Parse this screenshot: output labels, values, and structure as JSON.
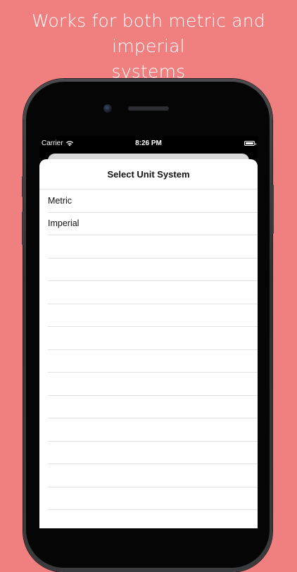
{
  "promo": {
    "headline_line1": "Works for both metric and imperial",
    "headline_line2": "systems"
  },
  "status_bar": {
    "carrier": "Carrier",
    "time": "8:26 PM"
  },
  "sheet": {
    "title": "Select Unit System",
    "options": [
      "Metric",
      "Imperial"
    ]
  },
  "colors": {
    "background": "#f08080",
    "sheet": "#ffffff",
    "separator": "#e3e3e3"
  },
  "icons": [
    "wifi-icon",
    "battery-icon",
    "camera-icon",
    "speaker-icon"
  ]
}
